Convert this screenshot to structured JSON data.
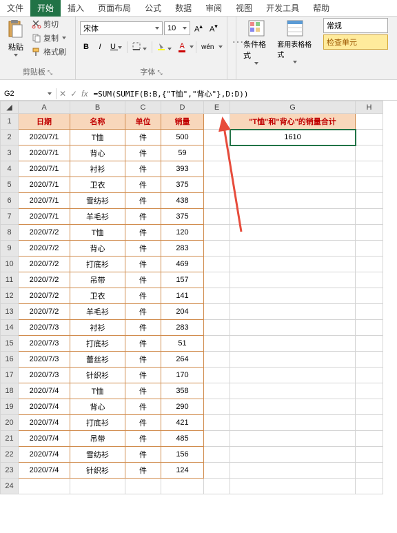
{
  "tabs": {
    "file": "文件",
    "home": "开始",
    "insert": "插入",
    "layout": "页面布局",
    "formulas": "公式",
    "data": "数据",
    "review": "审阅",
    "view": "视图",
    "developer": "开发工具",
    "help": "帮助"
  },
  "ribbon": {
    "clipboard": {
      "paste": "粘贴",
      "cut": "剪切",
      "copy": "复制",
      "format_painter": "格式刷",
      "group_label": "剪贴板"
    },
    "font": {
      "name": "宋体",
      "size": "10",
      "bold": "B",
      "italic": "I",
      "underline": "U",
      "wen": "wén",
      "group_label": "字体"
    },
    "styles": {
      "conditional": "条件格式",
      "cell_styles": "套用表格格式",
      "general": "常规",
      "check_cell": "检查单元"
    }
  },
  "name_box": "G2",
  "formula": "=SUM(SUMIF(B:B,{\"T恤\",\"背心\"},D:D))",
  "columns": [
    "A",
    "B",
    "C",
    "D",
    "E",
    "G",
    "H"
  ],
  "headers": {
    "date": "日期",
    "name": "名称",
    "unit": "单位",
    "sales": "销量"
  },
  "sum_label": "\"T恤\"和\"背心\"的销量合计",
  "sum_value": "1610",
  "rows": [
    {
      "n": "2",
      "date": "2020/7/1",
      "name": "T恤",
      "unit": "件",
      "sales": "500"
    },
    {
      "n": "3",
      "date": "2020/7/1",
      "name": "背心",
      "unit": "件",
      "sales": "59"
    },
    {
      "n": "4",
      "date": "2020/7/1",
      "name": "衬衫",
      "unit": "件",
      "sales": "393"
    },
    {
      "n": "5",
      "date": "2020/7/1",
      "name": "卫衣",
      "unit": "件",
      "sales": "375"
    },
    {
      "n": "6",
      "date": "2020/7/1",
      "name": "雪纺衫",
      "unit": "件",
      "sales": "438"
    },
    {
      "n": "7",
      "date": "2020/7/1",
      "name": "羊毛衫",
      "unit": "件",
      "sales": "375"
    },
    {
      "n": "8",
      "date": "2020/7/2",
      "name": "T恤",
      "unit": "件",
      "sales": "120"
    },
    {
      "n": "9",
      "date": "2020/7/2",
      "name": "背心",
      "unit": "件",
      "sales": "283"
    },
    {
      "n": "10",
      "date": "2020/7/2",
      "name": "打底衫",
      "unit": "件",
      "sales": "469"
    },
    {
      "n": "11",
      "date": "2020/7/2",
      "name": "吊带",
      "unit": "件",
      "sales": "157"
    },
    {
      "n": "12",
      "date": "2020/7/2",
      "name": "卫衣",
      "unit": "件",
      "sales": "141"
    },
    {
      "n": "13",
      "date": "2020/7/2",
      "name": "羊毛衫",
      "unit": "件",
      "sales": "204"
    },
    {
      "n": "14",
      "date": "2020/7/3",
      "name": "衬衫",
      "unit": "件",
      "sales": "283"
    },
    {
      "n": "15",
      "date": "2020/7/3",
      "name": "打底衫",
      "unit": "件",
      "sales": "51"
    },
    {
      "n": "16",
      "date": "2020/7/3",
      "name": "蕾丝衫",
      "unit": "件",
      "sales": "264"
    },
    {
      "n": "17",
      "date": "2020/7/3",
      "name": "针织衫",
      "unit": "件",
      "sales": "170"
    },
    {
      "n": "18",
      "date": "2020/7/4",
      "name": "T恤",
      "unit": "件",
      "sales": "358"
    },
    {
      "n": "19",
      "date": "2020/7/4",
      "name": "背心",
      "unit": "件",
      "sales": "290"
    },
    {
      "n": "20",
      "date": "2020/7/4",
      "name": "打底衫",
      "unit": "件",
      "sales": "421"
    },
    {
      "n": "21",
      "date": "2020/7/4",
      "name": "吊带",
      "unit": "件",
      "sales": "485"
    },
    {
      "n": "22",
      "date": "2020/7/4",
      "name": "雪纺衫",
      "unit": "件",
      "sales": "156"
    },
    {
      "n": "23",
      "date": "2020/7/4",
      "name": "针织衫",
      "unit": "件",
      "sales": "124"
    }
  ]
}
